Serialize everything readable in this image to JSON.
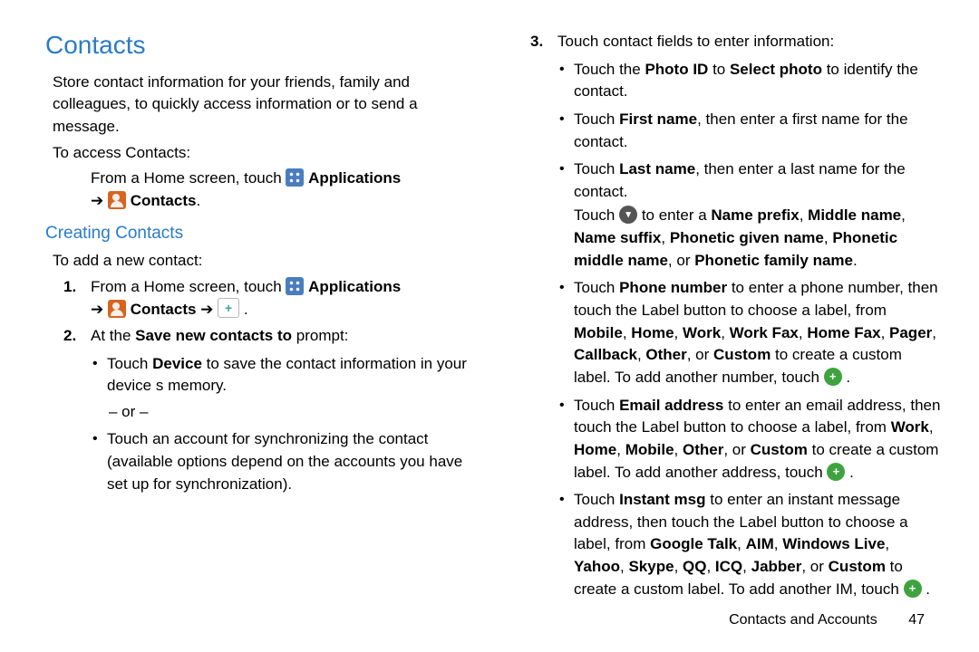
{
  "headings": {
    "h1": "Contacts",
    "h2": "Creating Contacts"
  },
  "left": {
    "intro": "Store contact information for your friends, family and colleagues, to quickly access information or to send a message.",
    "access": "To access Contacts:",
    "fromHome1_pre": "From a Home screen, touch ",
    "applications": "Applications",
    "arrow": " ➔ ",
    "contacts": "Contacts",
    "period": ".",
    "addNew": "To add a new contact:",
    "step1_pre": "From a Home screen, touch ",
    "step1_arrow2": " ➔ ",
    "step2_pre": "At the ",
    "step2_bold": "Save new contacts to",
    "step2_post": " prompt:",
    "b1_pre": "Touch ",
    "b1_bold": "Device",
    "b1_post": " to save the contact information in your device s memory.",
    "or": "– or –",
    "b2": "Touch an account for synchronizing the contact (available options depend on the accounts you have set up for synchronization)."
  },
  "right": {
    "step3": "Touch contact fields to enter information:",
    "photo_pre": "Touch the ",
    "photo_b1": "Photo ID",
    "photo_mid": " to ",
    "photo_b2": "Select photo",
    "photo_post": " to identify the contact.",
    "fn_pre": "Touch ",
    "fn_b": "First name",
    "fn_post": ", then enter a first name for the contact.",
    "ln_pre": "Touch ",
    "ln_b": "Last name",
    "ln_post": ", then enter a last name for the contact.",
    "lnsub_pre": "Touch ",
    "lnsub_mid": " to enter a ",
    "lnsub_b1": "Name prefix",
    "lnsub_b2": "Middle name",
    "lnsub_b3": "Name suffix",
    "lnsub_b4": "Phonetic given name",
    "lnsub_b5": "Phonetic middle name",
    "lnsub_or": ", or ",
    "lnsub_b6": "Phonetic family name",
    "phone_pre": "Touch ",
    "phone_b": "Phone number",
    "phone_post1": " to enter a phone number, then touch the Label button to choose a label, from ",
    "phone_l1": "Mobile",
    "phone_l2": "Home",
    "phone_l3": "Work",
    "phone_l4": "Work Fax",
    "phone_l5": "Home Fax",
    "phone_l6": "Pager",
    "phone_l7": "Callback",
    "phone_l8": "Other",
    "phone_or": ", or ",
    "phone_l9": "Custom",
    "phone_post2": " to create a custom label. To add another number, touch ",
    "email_pre": "Touch ",
    "email_b": "Email address",
    "email_post1": " to enter an email address, then touch the Label button to choose a label, from ",
    "email_l1": "Work",
    "email_l2": "Home",
    "email_l3": "Mobile",
    "email_l4": "Other",
    "email_or": ", or ",
    "email_l5": "Custom",
    "email_post2": " to create a custom label. To add another address, touch ",
    "im_pre": "Touch ",
    "im_b": "Instant msg",
    "im_post1": " to enter an instant message address, then touch the Label button to choose a label, from ",
    "im_l1": "Google Talk",
    "im_l2": "AIM",
    "im_l3": "Windows Live",
    "im_l4": "Yahoo",
    "im_l5": "Skype",
    "im_l6": "QQ",
    "im_l7": "ICQ",
    "im_l8": "Jabber",
    "im_or": ", or ",
    "im_l9": "Custom",
    "im_post2": " to create a custom label. To add another IM, touch "
  },
  "footer": {
    "section": "Contacts and Accounts",
    "page": "47"
  },
  "sep": ", "
}
